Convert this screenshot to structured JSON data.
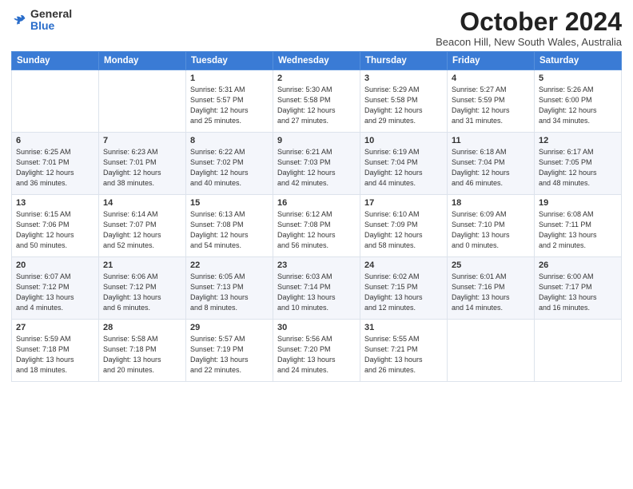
{
  "logo": {
    "general": "General",
    "blue": "Blue"
  },
  "title": "October 2024",
  "location": "Beacon Hill, New South Wales, Australia",
  "weekdays": [
    "Sunday",
    "Monday",
    "Tuesday",
    "Wednesday",
    "Thursday",
    "Friday",
    "Saturday"
  ],
  "weeks": [
    [
      {
        "day": "",
        "info": ""
      },
      {
        "day": "",
        "info": ""
      },
      {
        "day": "1",
        "info": "Sunrise: 5:31 AM\nSunset: 5:57 PM\nDaylight: 12 hours\nand 25 minutes."
      },
      {
        "day": "2",
        "info": "Sunrise: 5:30 AM\nSunset: 5:58 PM\nDaylight: 12 hours\nand 27 minutes."
      },
      {
        "day": "3",
        "info": "Sunrise: 5:29 AM\nSunset: 5:58 PM\nDaylight: 12 hours\nand 29 minutes."
      },
      {
        "day": "4",
        "info": "Sunrise: 5:27 AM\nSunset: 5:59 PM\nDaylight: 12 hours\nand 31 minutes."
      },
      {
        "day": "5",
        "info": "Sunrise: 5:26 AM\nSunset: 6:00 PM\nDaylight: 12 hours\nand 34 minutes."
      }
    ],
    [
      {
        "day": "6",
        "info": "Sunrise: 6:25 AM\nSunset: 7:01 PM\nDaylight: 12 hours\nand 36 minutes."
      },
      {
        "day": "7",
        "info": "Sunrise: 6:23 AM\nSunset: 7:01 PM\nDaylight: 12 hours\nand 38 minutes."
      },
      {
        "day": "8",
        "info": "Sunrise: 6:22 AM\nSunset: 7:02 PM\nDaylight: 12 hours\nand 40 minutes."
      },
      {
        "day": "9",
        "info": "Sunrise: 6:21 AM\nSunset: 7:03 PM\nDaylight: 12 hours\nand 42 minutes."
      },
      {
        "day": "10",
        "info": "Sunrise: 6:19 AM\nSunset: 7:04 PM\nDaylight: 12 hours\nand 44 minutes."
      },
      {
        "day": "11",
        "info": "Sunrise: 6:18 AM\nSunset: 7:04 PM\nDaylight: 12 hours\nand 46 minutes."
      },
      {
        "day": "12",
        "info": "Sunrise: 6:17 AM\nSunset: 7:05 PM\nDaylight: 12 hours\nand 48 minutes."
      }
    ],
    [
      {
        "day": "13",
        "info": "Sunrise: 6:15 AM\nSunset: 7:06 PM\nDaylight: 12 hours\nand 50 minutes."
      },
      {
        "day": "14",
        "info": "Sunrise: 6:14 AM\nSunset: 7:07 PM\nDaylight: 12 hours\nand 52 minutes."
      },
      {
        "day": "15",
        "info": "Sunrise: 6:13 AM\nSunset: 7:08 PM\nDaylight: 12 hours\nand 54 minutes."
      },
      {
        "day": "16",
        "info": "Sunrise: 6:12 AM\nSunset: 7:08 PM\nDaylight: 12 hours\nand 56 minutes."
      },
      {
        "day": "17",
        "info": "Sunrise: 6:10 AM\nSunset: 7:09 PM\nDaylight: 12 hours\nand 58 minutes."
      },
      {
        "day": "18",
        "info": "Sunrise: 6:09 AM\nSunset: 7:10 PM\nDaylight: 13 hours\nand 0 minutes."
      },
      {
        "day": "19",
        "info": "Sunrise: 6:08 AM\nSunset: 7:11 PM\nDaylight: 13 hours\nand 2 minutes."
      }
    ],
    [
      {
        "day": "20",
        "info": "Sunrise: 6:07 AM\nSunset: 7:12 PM\nDaylight: 13 hours\nand 4 minutes."
      },
      {
        "day": "21",
        "info": "Sunrise: 6:06 AM\nSunset: 7:12 PM\nDaylight: 13 hours\nand 6 minutes."
      },
      {
        "day": "22",
        "info": "Sunrise: 6:05 AM\nSunset: 7:13 PM\nDaylight: 13 hours\nand 8 minutes."
      },
      {
        "day": "23",
        "info": "Sunrise: 6:03 AM\nSunset: 7:14 PM\nDaylight: 13 hours\nand 10 minutes."
      },
      {
        "day": "24",
        "info": "Sunrise: 6:02 AM\nSunset: 7:15 PM\nDaylight: 13 hours\nand 12 minutes."
      },
      {
        "day": "25",
        "info": "Sunrise: 6:01 AM\nSunset: 7:16 PM\nDaylight: 13 hours\nand 14 minutes."
      },
      {
        "day": "26",
        "info": "Sunrise: 6:00 AM\nSunset: 7:17 PM\nDaylight: 13 hours\nand 16 minutes."
      }
    ],
    [
      {
        "day": "27",
        "info": "Sunrise: 5:59 AM\nSunset: 7:18 PM\nDaylight: 13 hours\nand 18 minutes."
      },
      {
        "day": "28",
        "info": "Sunrise: 5:58 AM\nSunset: 7:18 PM\nDaylight: 13 hours\nand 20 minutes."
      },
      {
        "day": "29",
        "info": "Sunrise: 5:57 AM\nSunset: 7:19 PM\nDaylight: 13 hours\nand 22 minutes."
      },
      {
        "day": "30",
        "info": "Sunrise: 5:56 AM\nSunset: 7:20 PM\nDaylight: 13 hours\nand 24 minutes."
      },
      {
        "day": "31",
        "info": "Sunrise: 5:55 AM\nSunset: 7:21 PM\nDaylight: 13 hours\nand 26 minutes."
      },
      {
        "day": "",
        "info": ""
      },
      {
        "day": "",
        "info": ""
      }
    ]
  ]
}
